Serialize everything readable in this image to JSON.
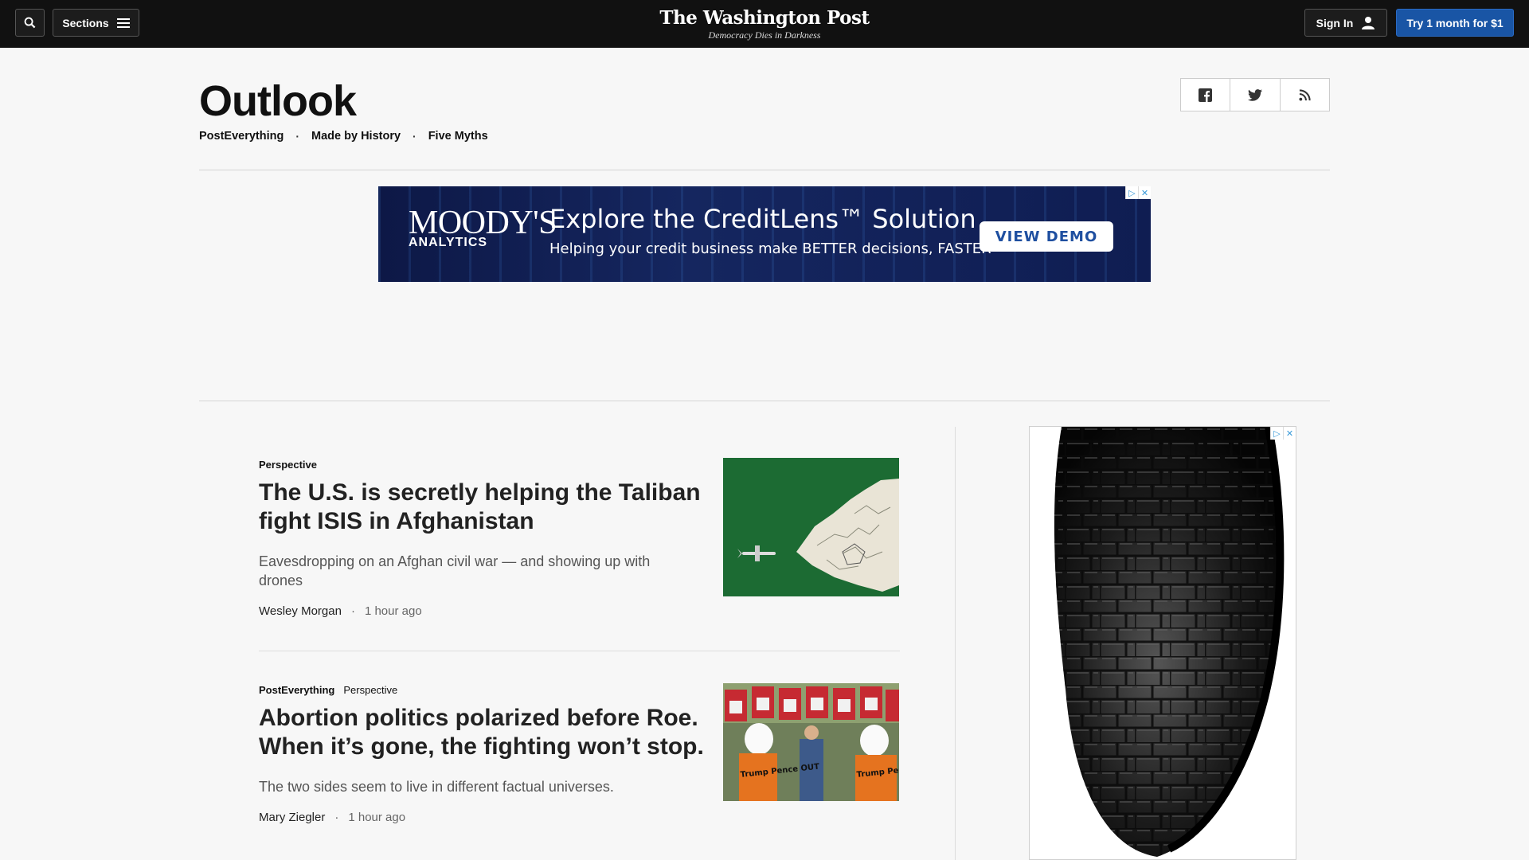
{
  "header": {
    "sections_label": "Sections",
    "logo_name": "The Washington Post",
    "logo_tagline": "Democracy Dies in Darkness",
    "signin_label": "Sign In",
    "trial_label": "Try 1 month for $1"
  },
  "page": {
    "title": "Outlook",
    "subnav": [
      "PostEverything",
      "Made by History",
      "Five Myths"
    ]
  },
  "banner_ad": {
    "brand": "MOODY'S",
    "brand_sub": "ANALYTICS",
    "headline": "Explore the CreditLens™ Solution",
    "subline": "Helping your credit business make BETTER decisions, FASTER",
    "cta": "VIEW DEMO",
    "accent": "#0d1846"
  },
  "articles": [
    {
      "kicker": "Perspective",
      "kicker2": "",
      "headline": "The U.S. is secretly helping the Taliban fight ISIS in Afghanistan",
      "blurb": "Eavesdropping on an Afghan civil war — and showing up with drones",
      "author": "Wesley Morgan",
      "time": "1 hour ago"
    },
    {
      "kicker": "PostEverything",
      "kicker2": "Perspective",
      "headline": "Abortion politics polarized before Roe. When it’s gone, the fighting won’t stop.",
      "blurb": "The two sides seem to live in different factual universes.",
      "author": "Mary Ziegler",
      "time": "1 hour ago",
      "image_sign_text": "Trump Pence OUT"
    }
  ],
  "colors": {
    "topbar": "#111111",
    "trial_button": "#1955a5",
    "background": "#f7f7f7"
  }
}
